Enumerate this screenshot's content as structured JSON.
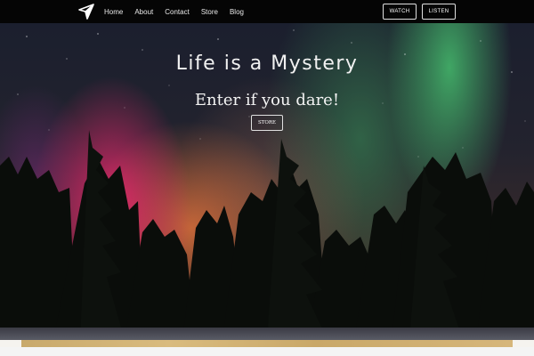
{
  "navbar": {
    "logo_icon": "paper-plane-icon",
    "links": [
      {
        "label": "Home"
      },
      {
        "label": "About"
      },
      {
        "label": "Contact"
      },
      {
        "label": "Store"
      },
      {
        "label": "Blog"
      }
    ],
    "watch_label": "WATCH",
    "listen_label": "LISTEN"
  },
  "hero": {
    "title": "Life is a Mystery",
    "subtitle": "Enter if you dare!",
    "store_label": "STORE",
    "background": "aurora-over-pine-forest"
  },
  "colors": {
    "navbar_bg": "#050505",
    "text": "#f1f1f1",
    "aurora_pink": "#eb286e",
    "aurora_green": "#46be6e"
  }
}
